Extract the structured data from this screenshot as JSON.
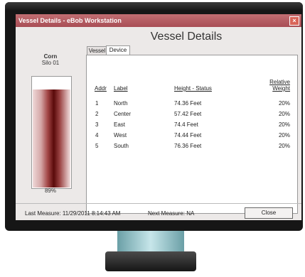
{
  "window": {
    "title": "Vessel Details - eBob Workstation",
    "heading": "Vessel Details"
  },
  "vessel": {
    "product": "Corn",
    "name": "Silo 01",
    "level_percent": 89,
    "level_label": "89%"
  },
  "tabs": [
    {
      "label": "Vessel",
      "active": false
    },
    {
      "label": "Device",
      "active": true
    }
  ],
  "table": {
    "headers": {
      "addr": "Addr",
      "label": "Label",
      "height": "Height - Status",
      "weight_line1": "Relative",
      "weight_line2": "Weight"
    },
    "rows": [
      {
        "addr": "1",
        "label": "North",
        "height": "74.36  Feet",
        "weight": "20%"
      },
      {
        "addr": "2",
        "label": "Center",
        "height": "57.42  Feet",
        "weight": "20%"
      },
      {
        "addr": "3",
        "label": "East",
        "height": "74.4  Feet",
        "weight": "20%"
      },
      {
        "addr": "4",
        "label": "West",
        "height": "74.44  Feet",
        "weight": "20%"
      },
      {
        "addr": "5",
        "label": "South",
        "height": "76.36  Feet",
        "weight": "20%"
      }
    ]
  },
  "status": {
    "last_measure": "Last Measure: 11/29/2011 8:14:43 AM",
    "next_measure": "Next Measure: NA"
  },
  "buttons": {
    "close": "Close",
    "titlebar_close": "×"
  }
}
